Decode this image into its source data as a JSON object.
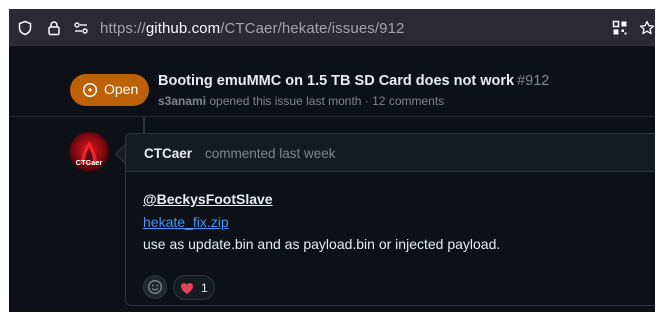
{
  "browser": {
    "url_prefix": "https://",
    "url_host": "github.com",
    "url_path": "/CTCaer/hekate/issues/912"
  },
  "issue": {
    "state": "Open",
    "title": "Booting emuMMC on 1.5 TB SD Card does not work",
    "number": "#912",
    "author": "s3anami",
    "meta": "opened this issue last month · 12 comments"
  },
  "comment": {
    "author": "CTCaer",
    "action": "commented last week",
    "avatar_text": "CTCaer",
    "mention": "@BeckysFootSlave",
    "file_link": "hekate_fix.zip",
    "text": "use as update.bin and as payload.bin or injected payload.",
    "reaction_count": "1"
  },
  "colors": {
    "page_bg": "#0d1117",
    "toolbar_bg": "#2b2a33",
    "open_badge": "#bd6109",
    "link": "#4493f8"
  }
}
